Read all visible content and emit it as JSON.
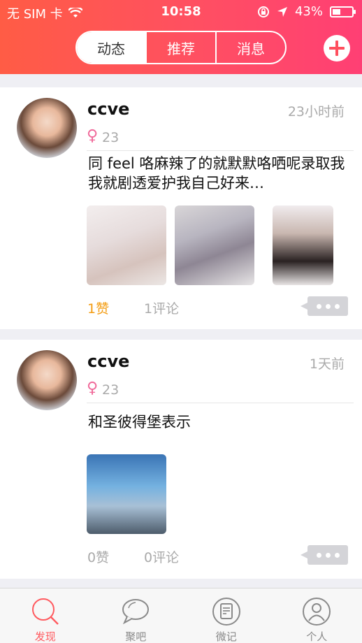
{
  "status_bar": {
    "carrier": "无 SIM 卡",
    "time": "10:58",
    "battery": "43%",
    "battery_level": 0.43
  },
  "header": {
    "tabs": [
      {
        "label": "动态",
        "active": true
      },
      {
        "label": "推荐",
        "active": false
      },
      {
        "label": "消息",
        "active": false
      }
    ],
    "add_icon": "plus-icon"
  },
  "feed": [
    {
      "username": "ccve",
      "time": "23小时前",
      "gender_icon": "female-icon",
      "age": "23",
      "text": "同 feel 咯麻辣了的就默默咯哂呢录取我我就剧透爱护我自己好来…",
      "photo_count": 3,
      "likes": "1赞",
      "comments": "1评论"
    },
    {
      "username": "ccve",
      "time": "1天前",
      "gender_icon": "female-icon",
      "age": "23",
      "text": "和圣彼得堡表示",
      "photo_count": 1,
      "likes": "0赞",
      "comments": "0评论"
    }
  ],
  "tabbar": [
    {
      "label": "发现",
      "icon": "search-icon",
      "active": true
    },
    {
      "label": "聚吧",
      "icon": "chat-bubble-icon",
      "active": false
    },
    {
      "label": "微记",
      "icon": "note-icon",
      "active": false
    },
    {
      "label": "个人",
      "icon": "person-icon",
      "active": false
    }
  ],
  "colors": {
    "header_gradient_start": "#ff5c45",
    "header_gradient_end": "#ff3f74",
    "accent": "#ff5a5f",
    "like_active": "#f39c12"
  }
}
